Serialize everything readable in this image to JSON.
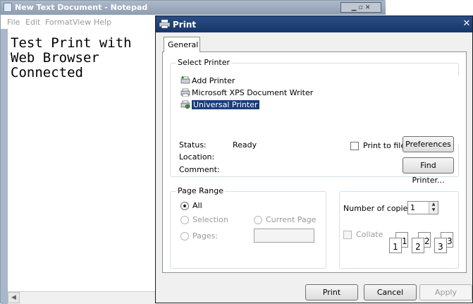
{
  "notepad": {
    "title": "New Text Document - Notepad",
    "menu": [
      "File",
      "Edit",
      "Format",
      "View",
      "Help"
    ],
    "content_lines": [
      "Test Print with",
      "Web Browser",
      "Connected"
    ]
  },
  "dialog": {
    "title": "Print",
    "tab": "General",
    "select_printer_label": "Select Printer",
    "printers": [
      {
        "name": "Add Printer",
        "icon": "add-printer-icon",
        "selected": false
      },
      {
        "name": "Microsoft XPS Document Writer",
        "icon": "printer-icon",
        "selected": false
      },
      {
        "name": "Universal Printer",
        "icon": "network-printer-icon",
        "selected": true
      }
    ],
    "status_label": "Status:",
    "status_value": "Ready",
    "location_label": "Location:",
    "comment_label": "Comment:",
    "print_to_file_label": "Print to file",
    "preferences_button": "Preferences",
    "find_printer_button": "Find Printer...",
    "page_range_label": "Page Range",
    "range_all": "All",
    "range_selection": "Selection",
    "range_current_page": "Current Page",
    "range_pages": "Pages:",
    "copies_label": "Number of copies:",
    "copies_value": "1",
    "collate_label": "Collate",
    "collate_pages": [
      "1",
      "1",
      "2",
      "2",
      "3",
      "3"
    ],
    "print_button": "Print",
    "cancel_button": "Cancel",
    "apply_button": "Apply"
  }
}
